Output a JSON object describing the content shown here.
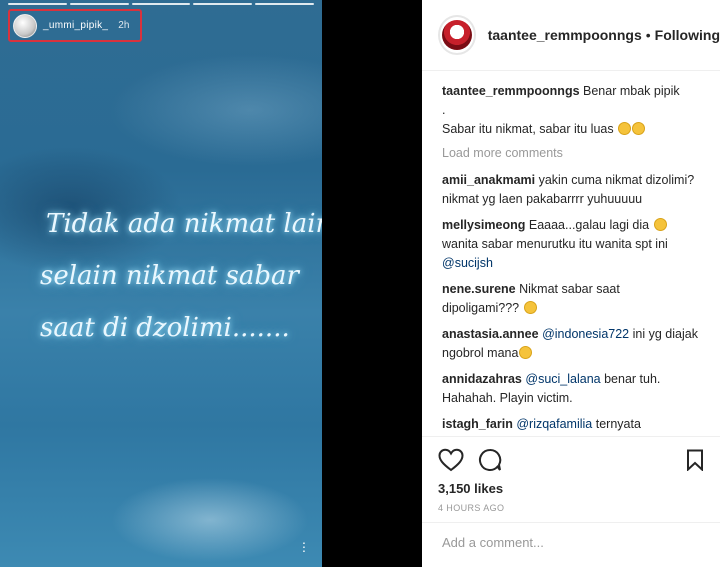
{
  "story": {
    "username": "_ummi_pipik_",
    "time": "2h",
    "lines": [
      "Tidak ada nikmat lain",
      "selain nikmat sabar",
      "saat di dzolimi......."
    ],
    "more_icon": "vertical-ellipsis-icon"
  },
  "post": {
    "username": "taantee_remmpoonngs",
    "separator": "•",
    "follow_label": "Following",
    "caption_user": "taantee_remmpoonngs",
    "caption_line1": "Benar mbak pipik",
    "caption_line2": ".",
    "caption_line3": "Sabar itu nikmat, sabar itu luas",
    "load_more": "Load more comments",
    "comments": [
      {
        "user": "amii_anakmami",
        "text": "yakin cuma nikmat dizolimi? nikmat yg laen pakabarrrr yuhuuuuu"
      },
      {
        "user": "mellysimeong",
        "text_a": "Eaaaa...galau lagi dia",
        "text_b": "wanita sabar menurutku itu wanita spt ini",
        "mention": "@sucijsh"
      },
      {
        "user": "nene.surene",
        "text": "Nikmat sabar saat dipoligami???"
      },
      {
        "user": "anastasia.annee",
        "mention": "@indonesia722",
        "text": "ini yg diajak ngobrol mana"
      },
      {
        "user": "annidazahras",
        "mention": "@suci_lalana",
        "text": "benar tuh. Hahahah. Playin victim."
      },
      {
        "user": "istagh_farin",
        "mention": "@rizqafamilia",
        "text": "ternyata senengnmu komen Ng kene Yo op wkwk"
      }
    ],
    "likes": "3,150 likes",
    "ago": "4 HOURS AGO",
    "add_comment_placeholder": "Add a comment...",
    "icons": [
      "heart-icon",
      "comment-icon",
      "bookmark-icon"
    ]
  }
}
